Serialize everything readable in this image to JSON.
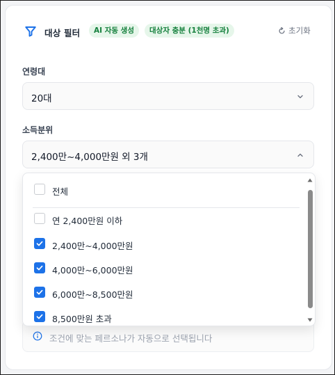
{
  "header": {
    "title": "대상 필터",
    "badge_ai": "AI 자동 생성",
    "badge_target": "대상자 충분 (1천명 초과)",
    "reset_label": "초기화"
  },
  "age": {
    "label": "연령대",
    "value": "20대"
  },
  "income": {
    "label": "소득분위",
    "value": "2,400만~4,000만원 외 3개",
    "options": [
      {
        "label": "전체",
        "checked": false
      },
      {
        "label": "연 2,400만원 이하",
        "checked": false
      },
      {
        "label": "2,400만~4,000만원",
        "checked": true
      },
      {
        "label": "4,000만~6,000만원",
        "checked": true
      },
      {
        "label": "6,000만~8,500만원",
        "checked": true
      },
      {
        "label": "8,500만원 초과",
        "checked": true
      }
    ]
  },
  "info": {
    "text": "조건에 맞는 페르소나가 자동으로 선택됩니다"
  },
  "colors": {
    "accent": "#1d72e8",
    "badge_bg": "#e6f6ea",
    "badge_text": "#15803d"
  }
}
